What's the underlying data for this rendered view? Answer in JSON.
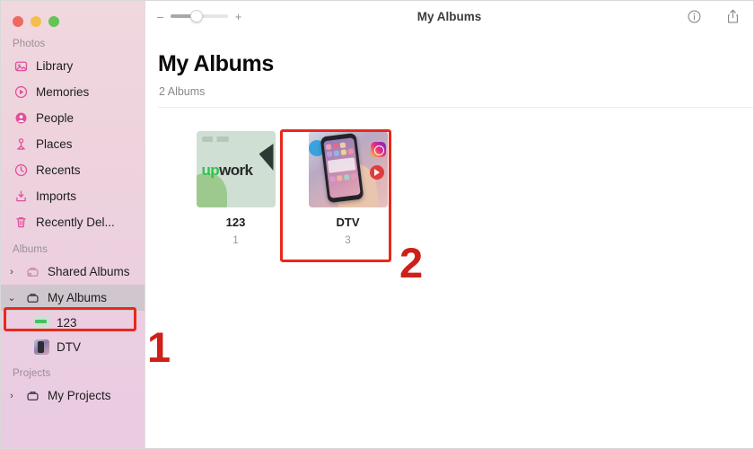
{
  "window": {
    "traffic_lights": [
      "close",
      "minimize",
      "maximize"
    ]
  },
  "toolbar": {
    "title": "My Albums",
    "zoom_minus": "–",
    "zoom_plus": "+",
    "zoom_value_percent": 45,
    "info_icon": "info-circle-icon",
    "share_icon": "share-icon"
  },
  "sidebar": {
    "sections": [
      {
        "label": "Photos",
        "items": [
          {
            "label": "Library",
            "icon": "photos-library-icon",
            "chevron": null,
            "selected": false
          },
          {
            "label": "Memories",
            "icon": "memories-icon",
            "chevron": null,
            "selected": false
          },
          {
            "label": "People",
            "icon": "people-icon",
            "chevron": null,
            "selected": false
          },
          {
            "label": "Places",
            "icon": "places-pin-icon",
            "chevron": null,
            "selected": false
          },
          {
            "label": "Recents",
            "icon": "clock-icon",
            "chevron": null,
            "selected": false
          },
          {
            "label": "Imports",
            "icon": "import-icon",
            "chevron": null,
            "selected": false
          },
          {
            "label": "Recently Del...",
            "icon": "trash-icon",
            "chevron": null,
            "selected": false
          }
        ]
      },
      {
        "label": "Albums",
        "items": [
          {
            "label": "Shared Albums",
            "icon": "shared-album-icon",
            "chevron": "right",
            "selected": false
          },
          {
            "label": "My Albums",
            "icon": "album-icon",
            "chevron": "down",
            "selected": true
          }
        ],
        "children": [
          {
            "label": "123",
            "thumb": "upwork-thumb"
          },
          {
            "label": "DTV",
            "thumb": "dtv-thumb"
          }
        ]
      },
      {
        "label": "Projects",
        "items": [
          {
            "label": "My Projects",
            "icon": "project-icon",
            "chevron": "right",
            "selected": false
          }
        ]
      }
    ]
  },
  "main": {
    "page_title": "My Albums",
    "subtitle": "2 Albums",
    "albums": [
      {
        "name": "123",
        "count": "1",
        "thumb": "upwork-thumb"
      },
      {
        "name": "DTV",
        "count": "3",
        "thumb": "dtv-thumb"
      }
    ]
  },
  "annotations": [
    {
      "number": "1",
      "target": "sidebar-my-albums",
      "color": "#cf1f1a"
    },
    {
      "number": "2",
      "target": "album-dtv",
      "color": "#cf1f1a"
    }
  ],
  "colors": {
    "annotation_red": "#e8291c",
    "sidebar_pink_top": "#f0d8de",
    "sidebar_pink_bottom": "#e9cbe2",
    "selection_grey": "#cfc7cd",
    "icon_pink": "#e0509a"
  }
}
